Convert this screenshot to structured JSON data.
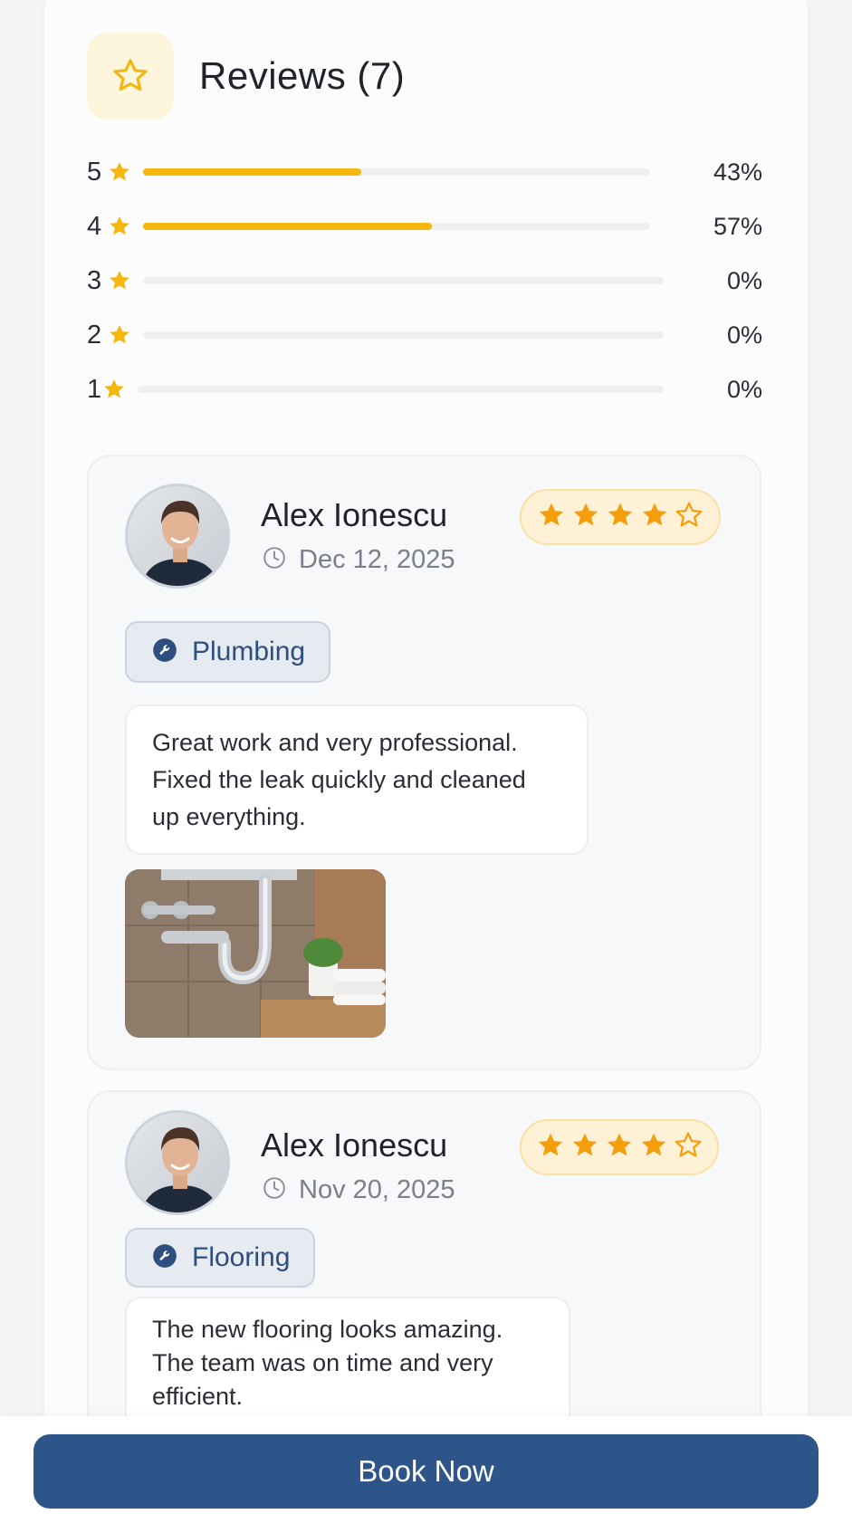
{
  "reviews_header": {
    "title": "Reviews (7)",
    "icon": "star-outline-icon"
  },
  "rating_distribution": [
    {
      "stars": "5",
      "percent_label": "43%",
      "fraction": 0.43
    },
    {
      "stars": "4",
      "percent_label": "57%",
      "fraction": 0.57
    },
    {
      "stars": "3",
      "percent_label": "0%",
      "fraction": 0
    },
    {
      "stars": "2",
      "percent_label": "0%",
      "fraction": 0
    },
    {
      "stars": "1",
      "percent_label": "0%",
      "fraction": 0
    }
  ],
  "reviews": [
    {
      "reviewer": "Alex Ionescu",
      "date": "Dec 12, 2025",
      "rating": 4,
      "rating_max": 5,
      "category": "Plumbing",
      "comment_lines": [
        "Great work and very professional.",
        "Fixed the leak quickly and cleaned",
        "up everything."
      ]
    },
    {
      "reviewer": "Alex Ionescu",
      "date": "Nov 20, 2025",
      "rating": 4,
      "rating_max": 5,
      "category": "Flooring",
      "comment_lines": [
        "The new flooring looks amazing.",
        "The team was on time and very",
        "efficient."
      ]
    }
  ],
  "footer": {
    "book_label": "Book Now"
  },
  "colors": {
    "accent_star": "#f5b70f",
    "rating_star": "#f59e0b",
    "primary_button": "#2d5589",
    "chip_text": "#2d4e7e"
  }
}
